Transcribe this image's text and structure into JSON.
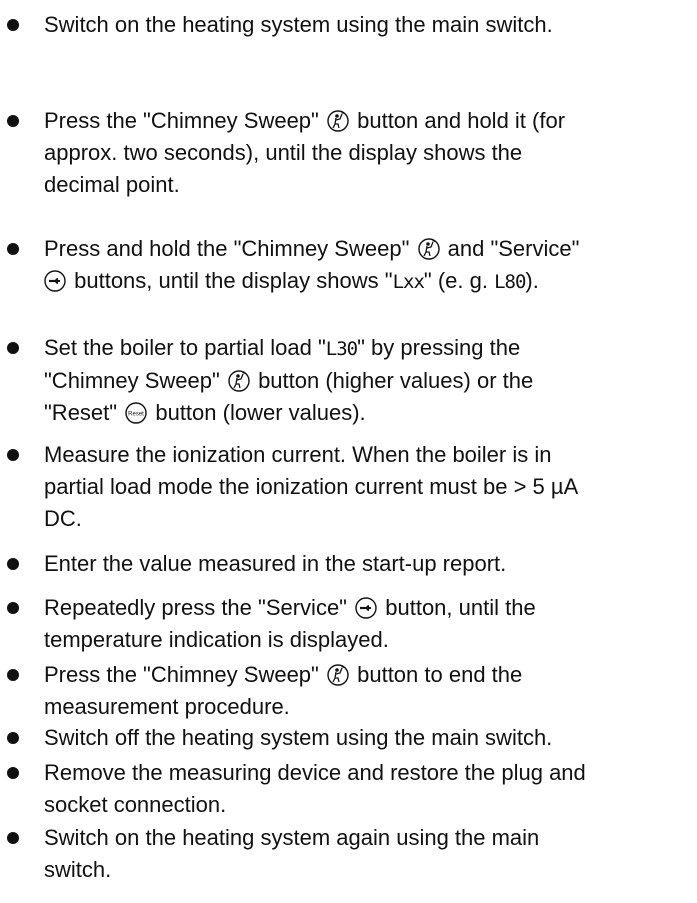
{
  "steps": [
    {
      "lines": [
        "Switch on the heating system using the main switch."
      ]
    },
    {
      "line1_pre": "Press the \"Chimney Sweep\"",
      "line1_post": "button and hold it (for",
      "line2": "approx. two seconds), until the display shows the",
      "line3": "decimal point."
    },
    {
      "line1_pre": "Press and hold the \"Chimney Sweep\"",
      "line1_post": "and \"Service\"",
      "line2_post": "buttons, until the display shows \"",
      "lxx": "Lxx",
      "line2_mid": "\" (e. g. ",
      "code": "L80",
      "line2_end": ")."
    },
    {
      "line1_pre": "Set the boiler to partial load \"",
      "code": "L30",
      "line1_post": "\" by pressing the",
      "line2_pre": "\"Chimney Sweep\"",
      "line2_post": "button (higher values) or the",
      "line3_pre": "\"Reset\"",
      "line3_post": "button (lower values)."
    },
    {
      "lines": [
        "Measure the ionization current. When the boiler is in",
        "partial load mode the ionization current must be > 5 µA",
        "DC."
      ]
    },
    {
      "lines": [
        "Enter the value measured in the start-up report."
      ]
    },
    {
      "line1_pre": "Repeatedly press the \"Service\"",
      "line1_post": "button, until the",
      "line2": "temperature indication is displayed."
    },
    {
      "line1_pre": "Press the \"Chimney Sweep\"",
      "line1_post": "button to end the",
      "line2": "measurement procedure."
    },
    {
      "lines": [
        "Switch off the heating system using the main switch."
      ]
    },
    {
      "lines": [
        "Remove the measuring device and restore the plug and",
        "socket connection."
      ]
    },
    {
      "lines": [
        "Switch on the heating system again using the main",
        "switch."
      ]
    }
  ],
  "icons": {
    "chimney_sweep": "chimney-sweep-icon",
    "service": "wrench-icon",
    "reset": "reset-icon",
    "reset_label": "Reset"
  }
}
